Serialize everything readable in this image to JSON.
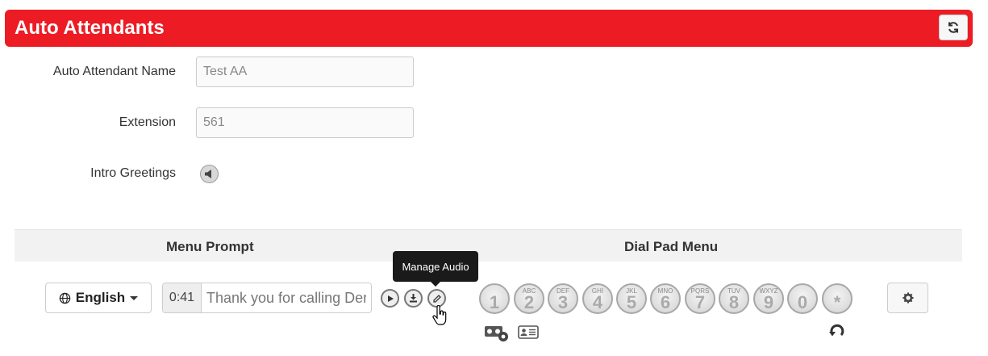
{
  "header": {
    "title": "Auto Attendants",
    "refresh_icon": "refresh-icon"
  },
  "form": {
    "name_label": "Auto Attendant Name",
    "name_value": "Test AA",
    "extension_label": "Extension",
    "extension_value": "561",
    "intro_label": "Intro Greetings"
  },
  "sections": {
    "menu_prompt": "Menu Prompt",
    "dial_pad": "Dial Pad Menu"
  },
  "language": {
    "selected": "English"
  },
  "prompt": {
    "duration": "0:41",
    "text": "Thank you for calling Dermatology"
  },
  "tooltip": "Manage Audio",
  "keys": [
    {
      "digit": "1",
      "letters": ""
    },
    {
      "digit": "2",
      "letters": "ABC"
    },
    {
      "digit": "3",
      "letters": "DEF"
    },
    {
      "digit": "4",
      "letters": "GHI"
    },
    {
      "digit": "5",
      "letters": "JKL"
    },
    {
      "digit": "6",
      "letters": "MNO"
    },
    {
      "digit": "7",
      "letters": "PQRS"
    },
    {
      "digit": "8",
      "letters": "TUV"
    },
    {
      "digit": "9",
      "letters": "WXYZ"
    },
    {
      "digit": "0",
      "letters": ""
    },
    {
      "digit": "*",
      "letters": ""
    }
  ],
  "colors": {
    "header": "#ed1c24"
  }
}
